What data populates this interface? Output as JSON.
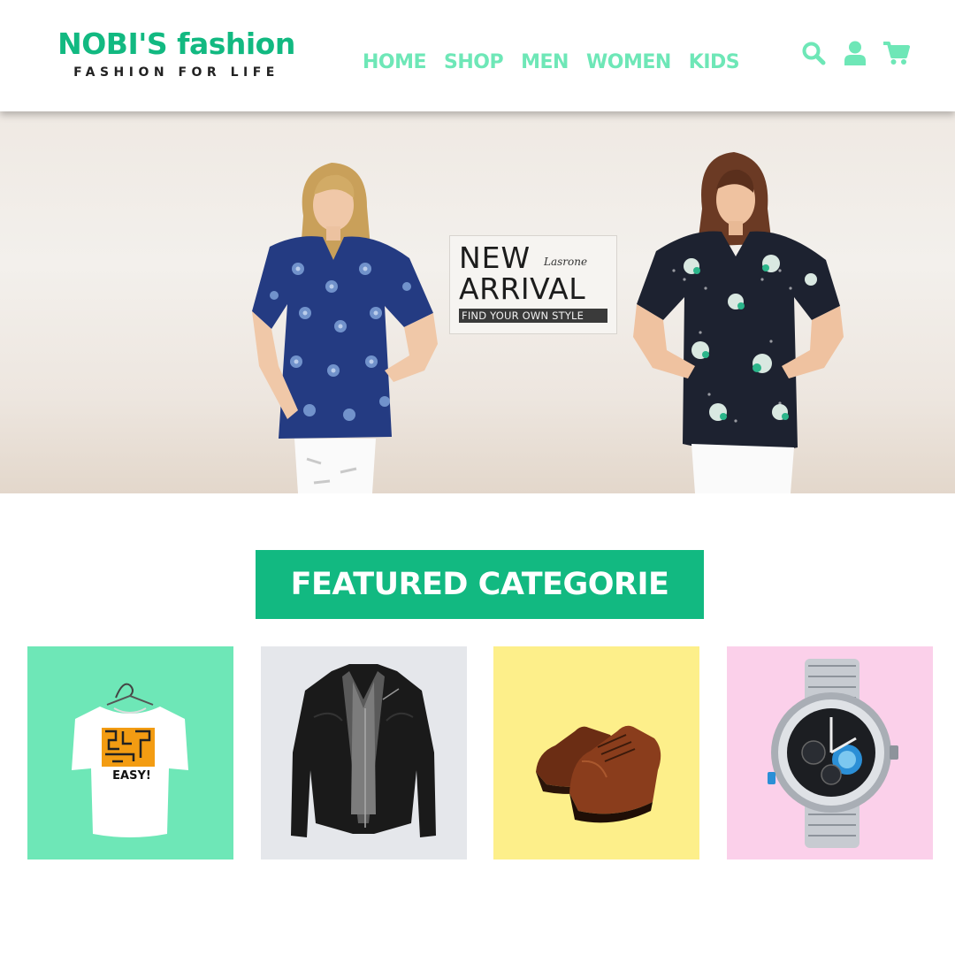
{
  "brand": {
    "name": "NOBI'S fashion",
    "tagline": "FASHION FOR LIFE"
  },
  "nav": {
    "items": [
      {
        "label": "HOME"
      },
      {
        "label": "SHOP"
      },
      {
        "label": "MEN"
      },
      {
        "label": "WOMEN"
      },
      {
        "label": "KIDS"
      }
    ]
  },
  "header_icons": [
    "search-icon",
    "user-icon",
    "cart-icon"
  ],
  "hero": {
    "promo": {
      "line1": "NEW",
      "script": "Lasrone",
      "line2": "ARRIVAL",
      "tagline": "FIND YOUR OWN STYLE"
    }
  },
  "featured": {
    "title": "FEATURED CATEGORIE",
    "categories": [
      {
        "image": "tshirt",
        "color": "#6ee7b7",
        "print_text": "EASY!"
      },
      {
        "image": "leather-jacket",
        "color": "#e5e7eb"
      },
      {
        "image": "leather-shoes",
        "color": "#fdef8a"
      },
      {
        "image": "wristwatch",
        "color": "#fbd0ea"
      }
    ]
  },
  "colors": {
    "brand_green": "#12b981",
    "nav_green": "#6ee7b7",
    "tagline_dark": "#222222"
  }
}
